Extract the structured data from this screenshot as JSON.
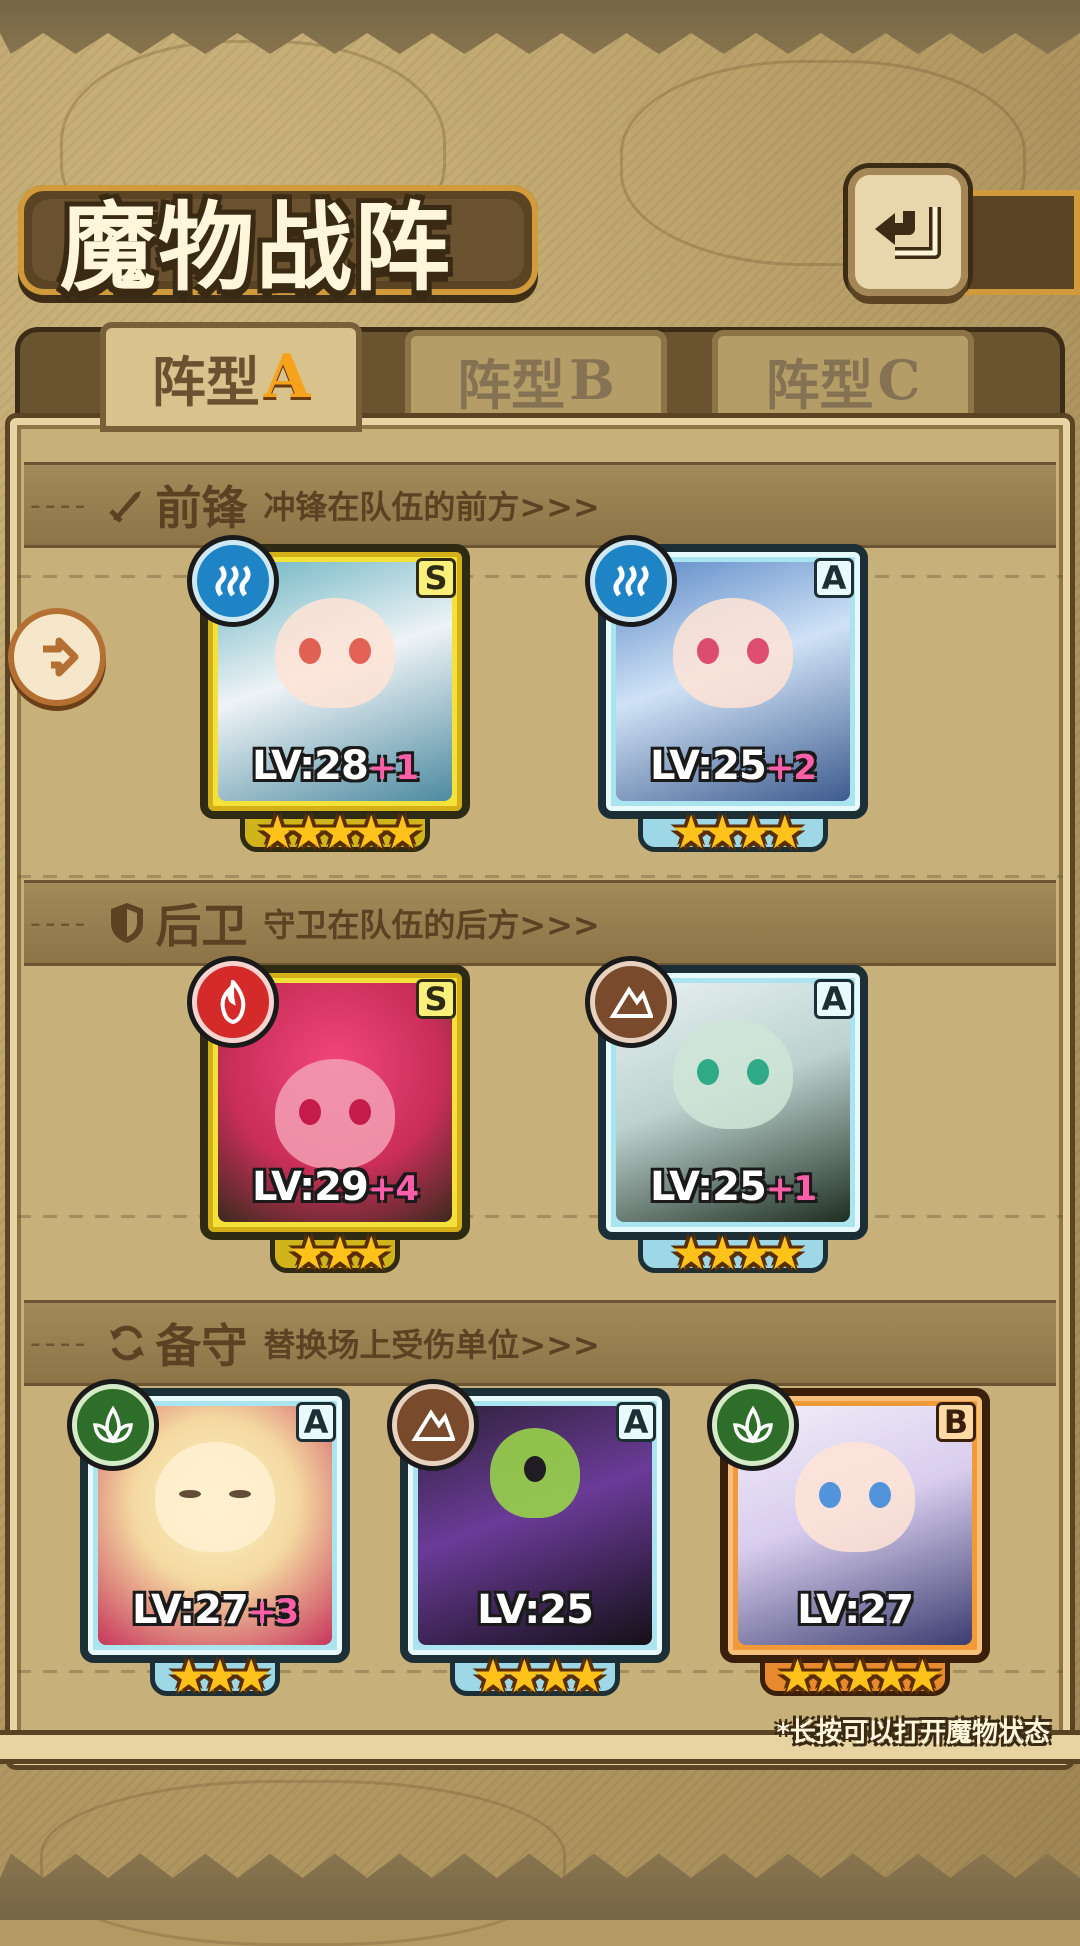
{
  "header": {
    "title": "魔物战阵",
    "back_icon": "return-arrow-icon"
  },
  "tabs": [
    {
      "zh": "阵型",
      "letter": "A",
      "active": true
    },
    {
      "zh": "阵型",
      "letter": "B",
      "active": false
    },
    {
      "zh": "阵型",
      "letter": "C",
      "active": false
    }
  ],
  "sections": {
    "front": {
      "title": "前锋",
      "desc": "冲锋在队伍的前方>>>",
      "icon": "sword-icon"
    },
    "back": {
      "title": "后卫",
      "desc": "守卫在队伍的后方>>>",
      "icon": "shield-icon"
    },
    "reserve": {
      "title": "备守",
      "desc": "替换场上受伤单位>>>",
      "icon": "swap-icon"
    }
  },
  "units": {
    "front": [
      {
        "rank": "S",
        "element": "water",
        "level": "LV:28",
        "plus": "+1",
        "stars": 5
      },
      {
        "rank": "A",
        "element": "water",
        "level": "LV:25",
        "plus": "+2",
        "stars": 4
      }
    ],
    "back": [
      {
        "rank": "S",
        "element": "fire",
        "level": "LV:29",
        "plus": "+4",
        "stars": 3
      },
      {
        "rank": "A",
        "element": "earth",
        "level": "LV:25",
        "plus": "+1",
        "stars": 4
      }
    ],
    "reserve": [
      {
        "rank": "A",
        "element": "nature",
        "level": "LV:27",
        "plus": "+3",
        "stars": 3
      },
      {
        "rank": "A",
        "element": "earth",
        "level": "LV:25",
        "plus": "",
        "stars": 4
      },
      {
        "rank": "B",
        "element": "nature",
        "level": "LV:27",
        "plus": "",
        "stars": 5
      }
    ]
  },
  "hint": "*长按可以打开魔物状态",
  "colors": {
    "accent": "#f6a21a",
    "plus": "#ff5fa8",
    "star": "#ffc21a"
  }
}
